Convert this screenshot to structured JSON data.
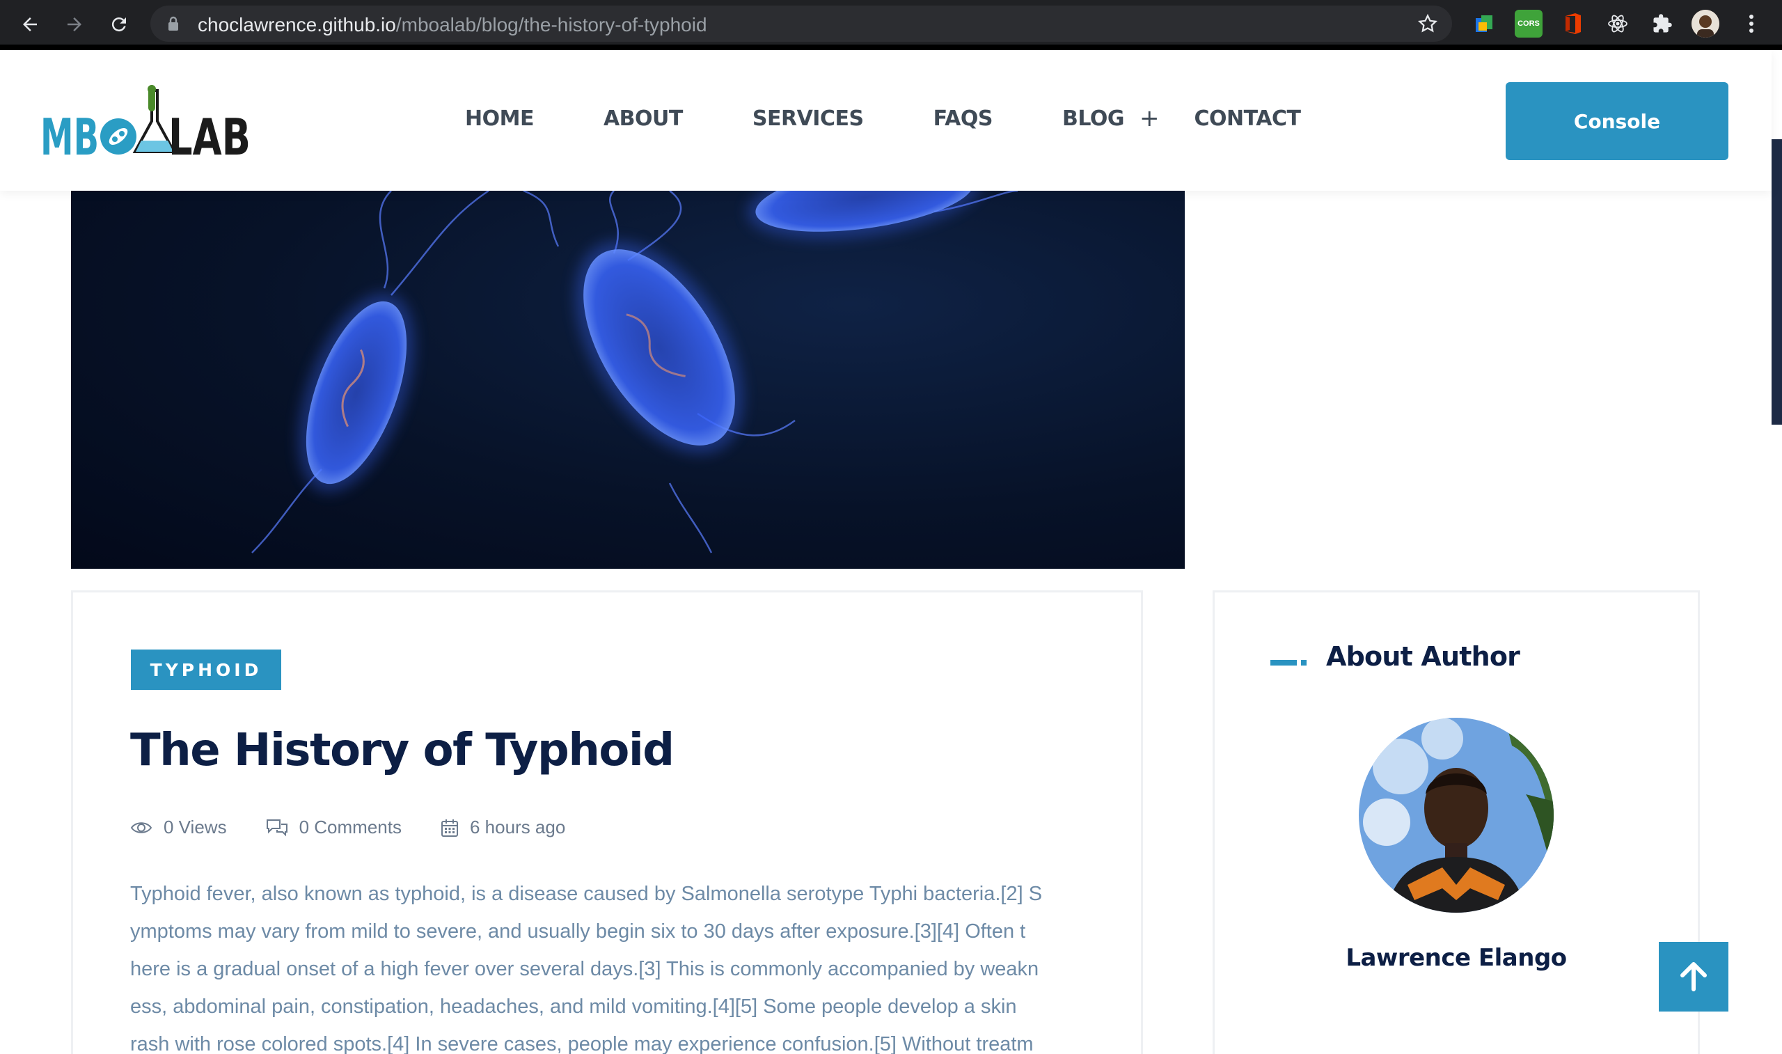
{
  "browser": {
    "url_host": "choclawrence.github.io",
    "url_path": "/mboalab/blog/the-history-of-typhoid",
    "extension_cors_label": "CORS"
  },
  "header": {
    "logo_text_left": "MB",
    "logo_text_right": "LAB",
    "nav": {
      "home": "HOME",
      "about": "ABOUT",
      "services": "SERVICES",
      "faqs": "FAQS",
      "blog": "BLOG",
      "blog_expand": "+",
      "contact": "CONTACT"
    },
    "console_button": "Console"
  },
  "article": {
    "tag": "TYPHOID",
    "title": "The History of Typhoid",
    "views": "0 Views",
    "comments": "0 Comments",
    "date": "6 hours ago",
    "body_lines": [
      "Typhoid fever, also known as typhoid, is a disease caused by Salmonella serotype Typhi bacteria.[2] S",
      "ymptoms may vary from mild to severe, and usually begin six to 30 days after exposure.[3][4] Often t",
      "here is a gradual onset of a high fever over several days.[3] This is commonly accompanied by weakn",
      "ess, abdominal pain, constipation, headaches, and mild vomiting.[4][5] Some people develop a skin",
      "rash with rose colored spots.[4] In severe cases, people may experience confusion.[5] Without treatm"
    ]
  },
  "sidebar": {
    "about_title": "About Author",
    "author_name": "Lawrence Elango"
  },
  "colors": {
    "accent": "#2a93c1",
    "heading": "#0d1f45",
    "body_text": "#6d8aa6"
  }
}
